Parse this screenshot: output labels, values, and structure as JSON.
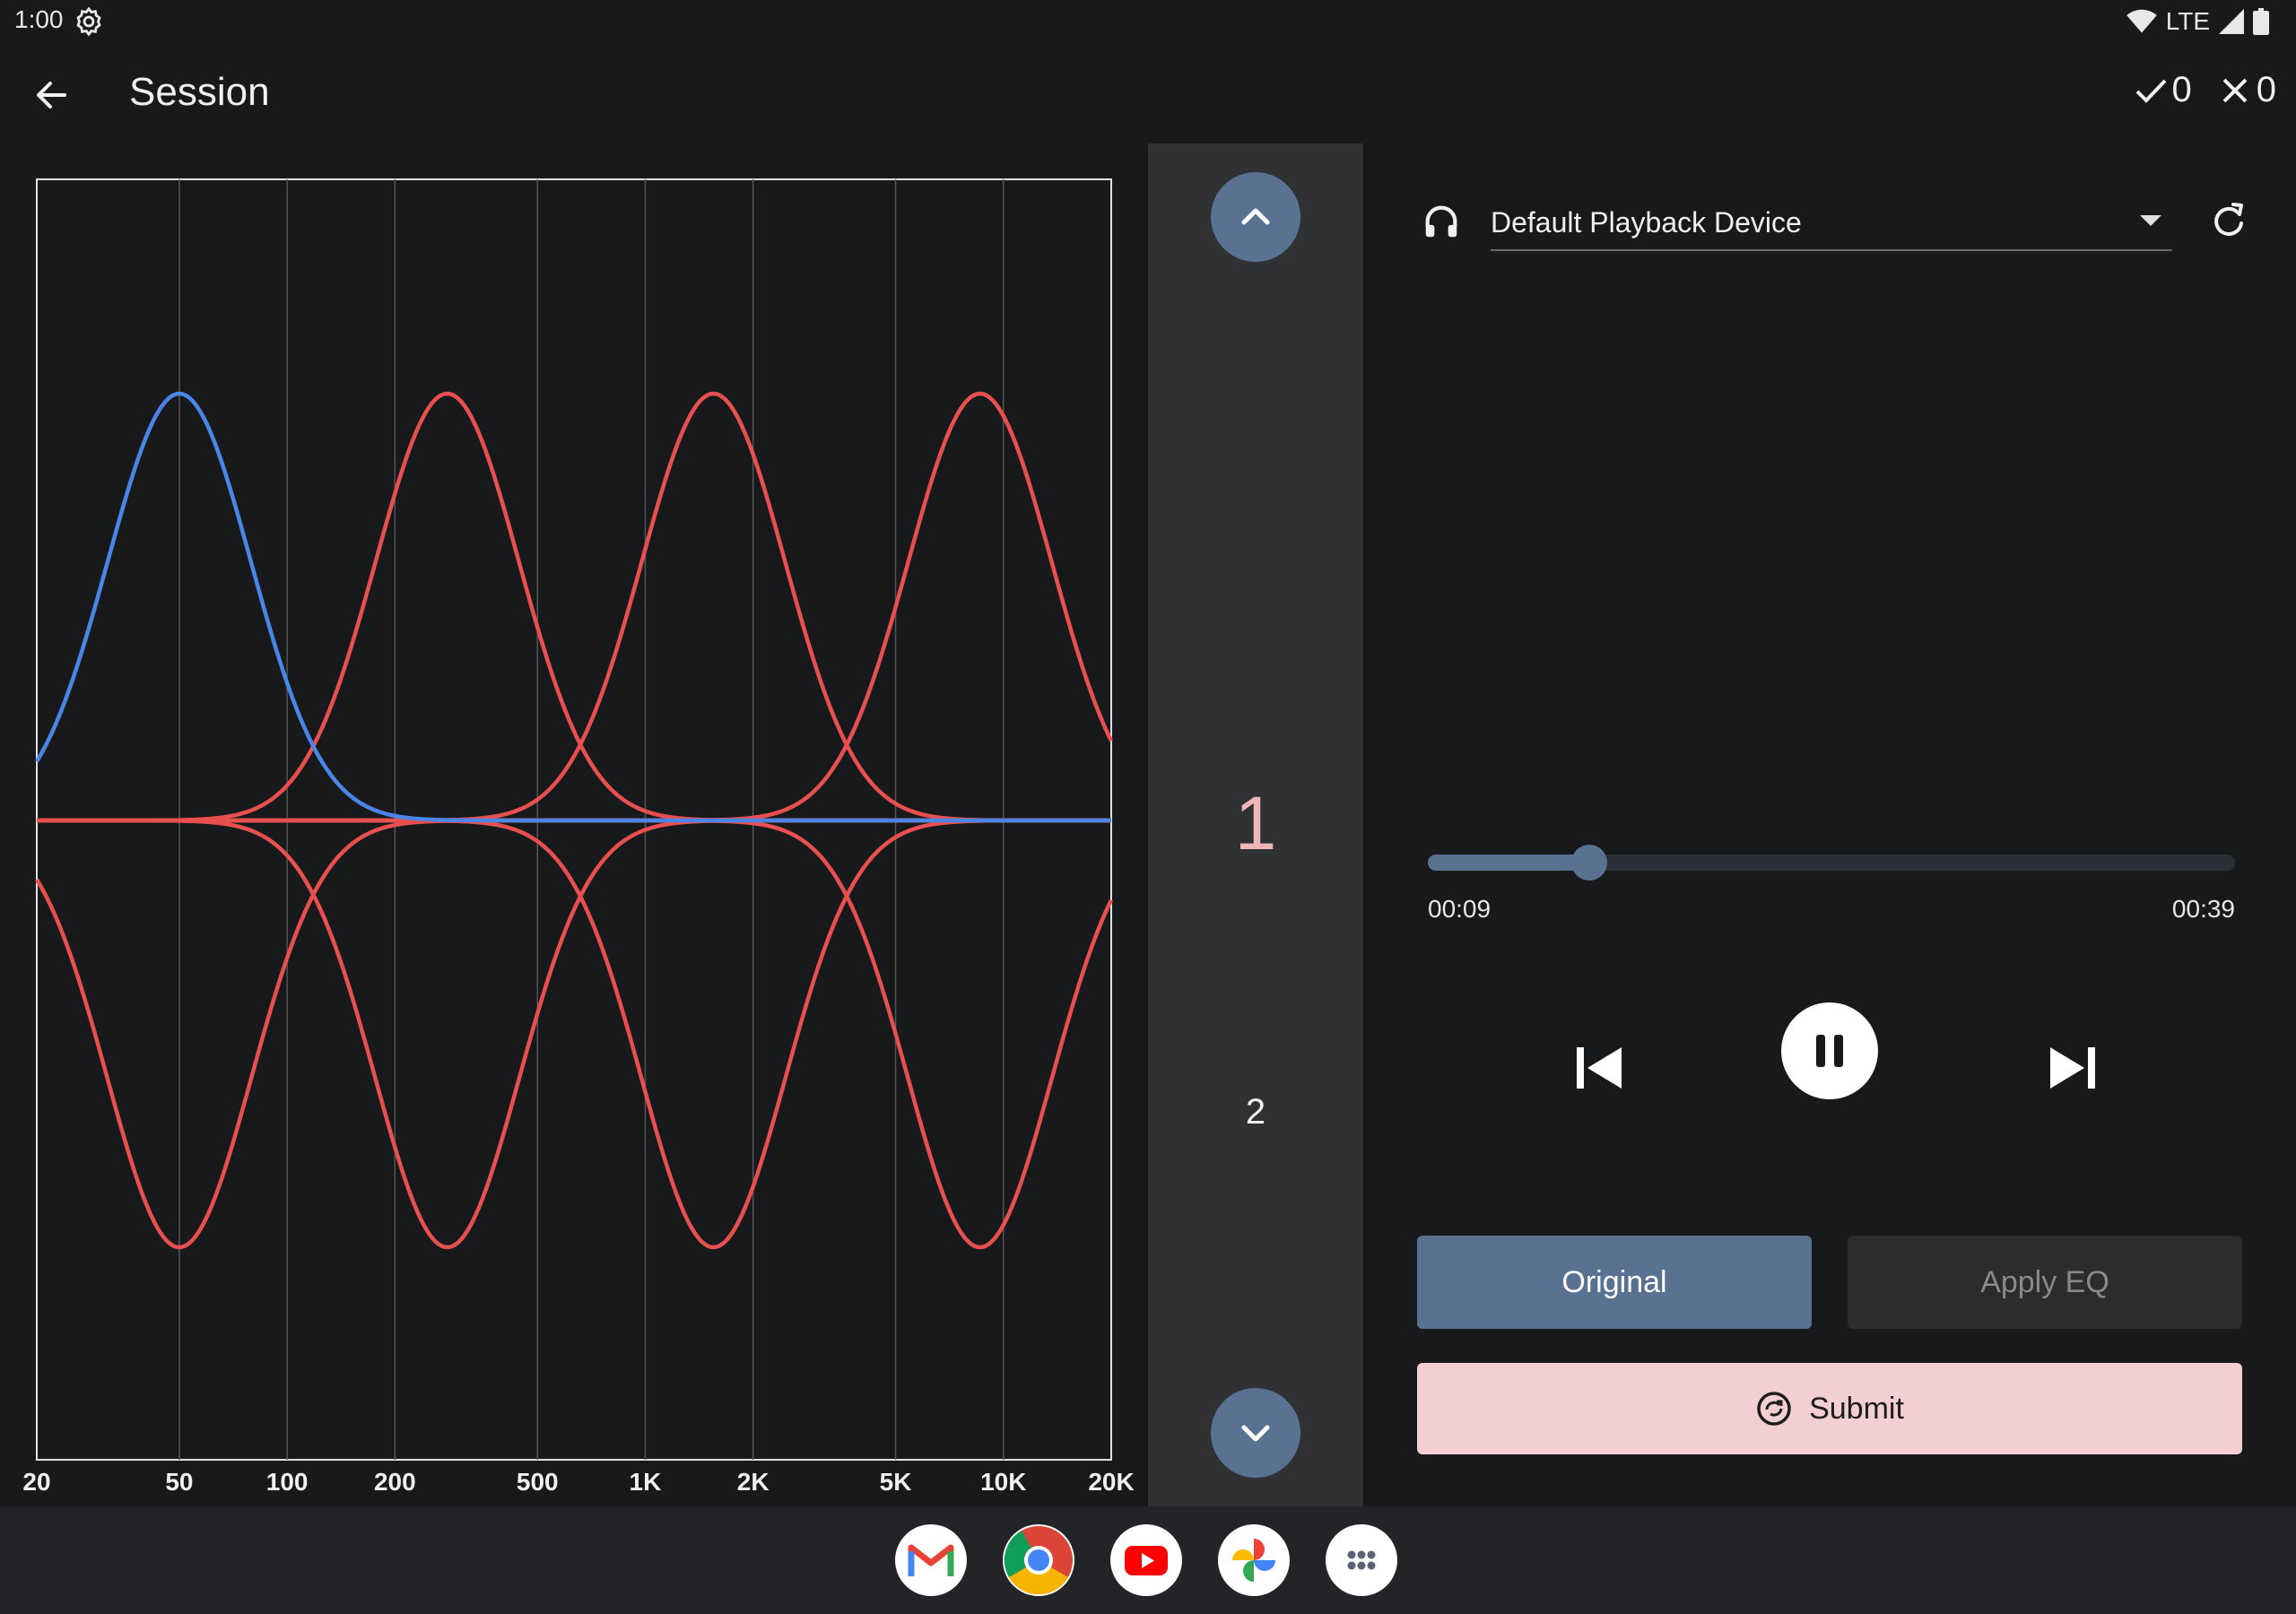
{
  "status_bar": {
    "time": "1:00",
    "network": "LTE"
  },
  "app_bar": {
    "title": "Session",
    "correct_count": "0",
    "wrong_count": "0"
  },
  "eq_chart": {
    "x_ticks": [
      "20",
      "50",
      "100",
      "200",
      "500",
      "1K",
      "2K",
      "5K",
      "10K",
      "20K"
    ],
    "colors": {
      "selected": "#4a86e8",
      "other": "#e8504f",
      "grid": "#555555"
    }
  },
  "chart_data": {
    "type": "line",
    "xlabel": "",
    "ylabel": "",
    "x_scale": "log",
    "xlim": [
      20,
      20000
    ],
    "x_ticks": [
      "20",
      "50",
      "100",
      "200",
      "500",
      "1K",
      "2K",
      "5K",
      "10K",
      "20K"
    ],
    "grid": true,
    "series": [
      {
        "center_hz": 50,
        "gain": 1,
        "color": "#4a86e8"
      },
      {
        "center_hz": 50,
        "gain": -1,
        "color": "#e8504f"
      },
      {
        "center_hz": 280,
        "gain": 1,
        "color": "#e8504f"
      },
      {
        "center_hz": 280,
        "gain": -1,
        "color": "#e8504f"
      },
      {
        "center_hz": 1550,
        "gain": 1,
        "color": "#e8504f"
      },
      {
        "center_hz": 1550,
        "gain": -1,
        "color": "#e8504f"
      },
      {
        "center_hz": 8600,
        "gain": 1,
        "color": "#e8504f"
      },
      {
        "center_hz": 8600,
        "gain": -1,
        "color": "#e8504f"
      }
    ]
  },
  "selector": {
    "options": [
      "1",
      "2"
    ],
    "selected": "1"
  },
  "player": {
    "device_label": "Default Playback Device",
    "current_time": "00:09",
    "total_time": "00:39",
    "progress": 0.2,
    "original_label": "Original",
    "apply_eq_label": "Apply EQ",
    "submit_label": "Submit"
  },
  "dock": {
    "apps": [
      "Gmail",
      "Chrome",
      "YouTube",
      "Photos",
      "App drawer"
    ]
  },
  "theme": {
    "accent": "#5a7292",
    "submit_bg": "#f3cfd3",
    "selected_number": "#f0b5b6"
  }
}
